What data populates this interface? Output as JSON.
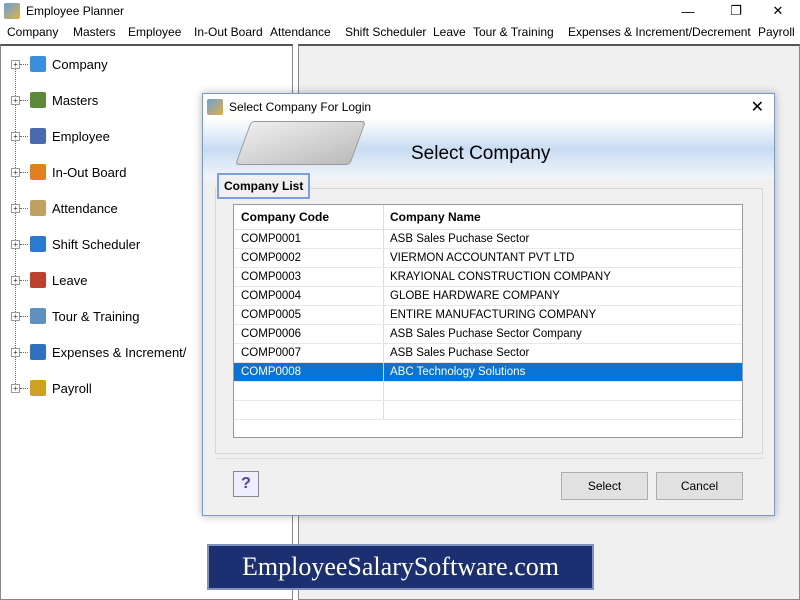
{
  "window": {
    "title": "Employee Planner",
    "controls": [
      "—",
      "❐",
      "✕"
    ]
  },
  "menu": [
    "Company",
    "Masters",
    "Employee",
    "In-Out Board",
    "Attendance",
    "Shift Scheduler",
    "Leave",
    "Tour & Training",
    "Expenses & Increment/Decrement",
    "Payroll"
  ],
  "tree": [
    {
      "label": "Company",
      "icon": "building-icon",
      "color": "#3a8ee0"
    },
    {
      "label": "Masters",
      "icon": "layers-icon",
      "color": "#5a8a3a"
    },
    {
      "label": "Employee",
      "icon": "users-icon",
      "color": "#4a6ab0"
    },
    {
      "label": "In-Out Board",
      "icon": "arrows-icon",
      "color": "#e08020"
    },
    {
      "label": "Attendance",
      "icon": "checklist-icon",
      "color": "#c0a060"
    },
    {
      "label": "Shift Scheduler",
      "icon": "clock-icon",
      "color": "#2a7ad0"
    },
    {
      "label": "Leave",
      "icon": "calendar-icon",
      "color": "#c04030"
    },
    {
      "label": "Tour & Training",
      "icon": "airplane-icon",
      "color": "#6090c0"
    },
    {
      "label": "Expenses & Increment/",
      "icon": "wallet-icon",
      "color": "#3070c0"
    },
    {
      "label": "Payroll",
      "icon": "coin-icon",
      "color": "#d0a020"
    }
  ],
  "dialog": {
    "title": "Select Company For Login",
    "heading": "Select Company",
    "group_label": "Company List",
    "columns": [
      "Company Code",
      "Company Name"
    ],
    "rows": [
      [
        "COMP0001",
        "ASB Sales Puchase Sector"
      ],
      [
        "COMP0002",
        "VIERMON ACCOUNTANT PVT LTD"
      ],
      [
        "COMP0003",
        "KRAYIONAL CONSTRUCTION COMPANY"
      ],
      [
        "COMP0004",
        "GLOBE HARDWARE COMPANY"
      ],
      [
        "COMP0005",
        "ENTIRE MANUFACTURING COMPANY"
      ],
      [
        "COMP0006",
        "ASB Sales Puchase Sector Company"
      ],
      [
        "COMP0007",
        "ASB Sales Puchase Sector"
      ],
      [
        "COMP0008",
        "ABC Technology Solutions"
      ]
    ],
    "selected_index": 7,
    "help_label": "?",
    "select_label": "Select",
    "cancel_label": "Cancel",
    "selection_color": "#0a74d6"
  },
  "watermark": "EmployeeSalarySoftware.com"
}
